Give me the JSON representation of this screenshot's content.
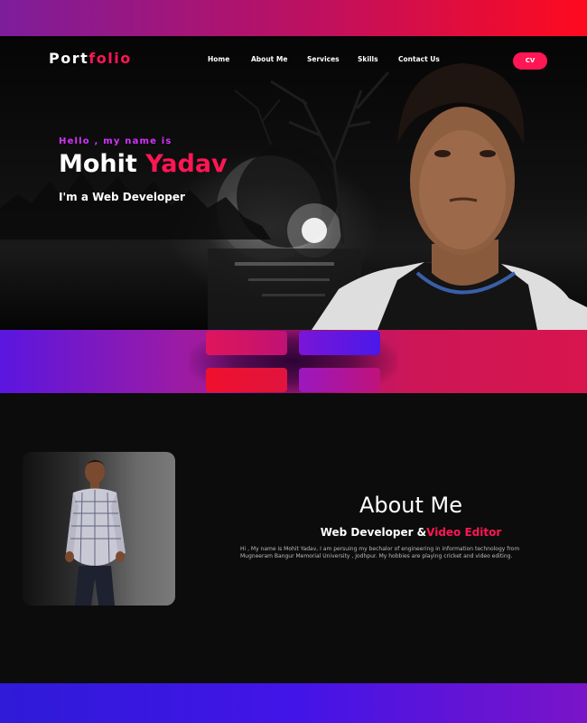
{
  "logo": {
    "part1": "Port",
    "part2": "folio"
  },
  "nav": {
    "items": [
      "Home",
      "About Me",
      "Services",
      "Skills",
      "Contact Us"
    ],
    "cv_label": "CV"
  },
  "hero": {
    "greeting": "Hello , my name is",
    "first_name": "Mohit",
    "last_name": "Yadav",
    "role": "I'm a Web Developer"
  },
  "about": {
    "title": "About Me",
    "subtitle_white": "Web Developer &",
    "subtitle_red": "Video Editor",
    "text": "Hi , My name is Mohit Yadav, I am persuing my bechalor of engineering in information technology from Mugneeram Bangur Memorial University , Jodhpur. My hobbies are playing cricket and video editing."
  },
  "colors": {
    "accent": "#ff1654",
    "purple": "#d633ff",
    "background": "#0c0c0c"
  }
}
